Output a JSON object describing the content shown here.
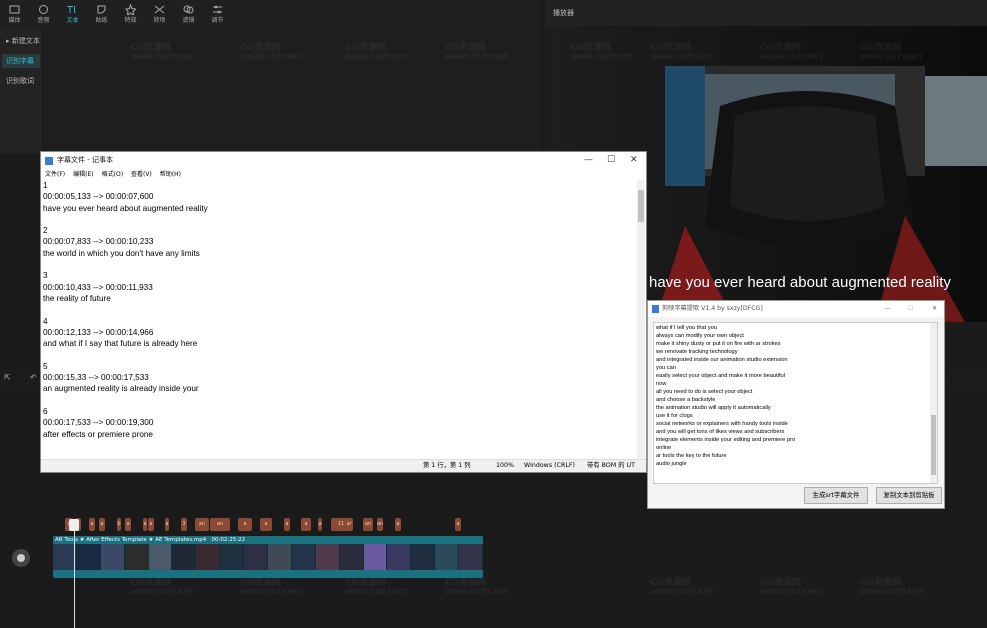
{
  "toolbar": {
    "items": [
      {
        "label": "媒体",
        "icon": "media-icon"
      },
      {
        "label": "音频",
        "icon": "audio-icon"
      },
      {
        "label": "文本",
        "icon": "text-icon",
        "active": true
      },
      {
        "label": "贴纸",
        "icon": "sticker-icon"
      },
      {
        "label": "特效",
        "icon": "effects-icon"
      },
      {
        "label": "转场",
        "icon": "transition-icon"
      },
      {
        "label": "滤镜",
        "icon": "filter-icon"
      },
      {
        "label": "调节",
        "icon": "adjust-icon"
      }
    ]
  },
  "sidebar": {
    "items": [
      {
        "label": "▸ 新建文本"
      },
      {
        "label": "识别字幕",
        "active": true
      },
      {
        "label": "识别歌词"
      }
    ]
  },
  "player": {
    "title": "播放器",
    "subtitle": "have you ever heard about augmented reality"
  },
  "watermark": {
    "line1": "CG资源网",
    "line2": "WWW.CGZY.NET"
  },
  "notepad": {
    "title": "字幕文件 - 记事本",
    "menu": [
      "文件(F)",
      "编辑(E)",
      "格式(O)",
      "查看(V)",
      "帮助(H)"
    ],
    "lines": [
      "1",
      "00:00:05,133 --> 00:00:07,600",
      "have you ever heard about augmented reality",
      "",
      "2",
      "00:00:07,833 --> 00:00:10,233",
      "the world in which you don't have any limits",
      "",
      "3",
      "00:00:10,433 --> 00:00:11,933",
      "the reality of future",
      "",
      "4",
      "00:00:12,133 --> 00:00:14,966",
      "and what if I say that future is already here",
      "",
      "5",
      "00:00:15,33 --> 00:00:17,533",
      "an augmented reality is already inside your",
      "",
      "6",
      "00:00:17,533 --> 00:00:19,300",
      "after effects or premiere prone"
    ],
    "status": {
      "position": "第 1 行，第 1 列",
      "zoom": "100%",
      "eol": "Windows (CRLF)",
      "encoding": "带有 BOM 的 UT"
    }
  },
  "extractor": {
    "title": "剪映字幕提取 V1.4 by sxzy[DFCG]",
    "lines": [
      "what if I tell you that you",
      "always can modify your own object",
      "make it shiny dusty or put it on fire with ar strokes",
      "we renovate tracking technology",
      "and integrated inside our animation studio extension",
      "you can",
      "easily select your object and make it more beautiful",
      "now",
      "all you need to do is select your object",
      "and choose a backstyle",
      "the animation studio will apply it automatically",
      "use it for clogs",
      "social networks or explainers with handy tools inside",
      "and you will get tons of likes views and subscribers",
      "integrate elements inside your editing and premiere pro",
      "online",
      "ar tools the key to the future",
      "audio jungle"
    ],
    "btn_generate": "生成srt字幕文件",
    "btn_copy": "复制文本到剪贴板"
  },
  "timeline": {
    "video_label": "AR Tools ★ After Effects Template ★ AE Templates.mp4",
    "video_duration": "00:02:25:22",
    "sub_chips": [
      "a",
      "a",
      "a",
      "a",
      "b",
      "a",
      "a",
      "a",
      "a",
      "3",
      "an",
      "an",
      "a",
      "a",
      "a",
      "a",
      "a",
      "11",
      "ar",
      "an",
      "an",
      "a",
      "a"
    ]
  }
}
